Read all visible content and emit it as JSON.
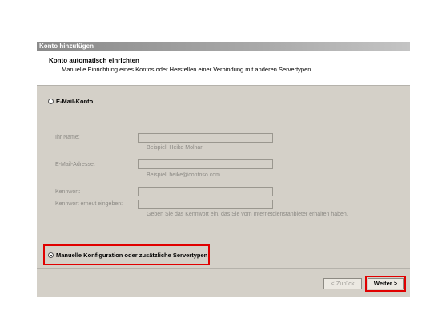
{
  "window": {
    "title": "Konto hinzufügen"
  },
  "header": {
    "title": "Konto automatisch einrichten",
    "subtitle": "Manuelle Einrichtung eines Kontos oder Herstellen einer Verbindung mit anderen Servertypen."
  },
  "email_option": {
    "label": "E-Mail-Konto",
    "selected": false,
    "fields": {
      "name": {
        "label": "Ihr Name:",
        "value": "",
        "hint": "Beispiel: Heike Molnar"
      },
      "email": {
        "label": "E-Mail-Adresse:",
        "value": "",
        "hint": "Beispiel: heike@contoso.com"
      },
      "password": {
        "label": "Kennwort:",
        "value": ""
      },
      "password_repeat": {
        "label": "Kennwort erneut eingeben:",
        "value": ""
      },
      "password_hint": "Geben Sie das Kennwort ein, das Sie vom Internetdienstanbieter erhalten haben."
    }
  },
  "manual_option": {
    "label": "Manuelle Konfiguration oder zusätzliche Servertypen",
    "selected": true
  },
  "buttons": {
    "back": "< Zurück",
    "next": "Weiter >"
  },
  "colors": {
    "highlight": "#e00000",
    "dialog_bg": "#d4d0c8"
  }
}
